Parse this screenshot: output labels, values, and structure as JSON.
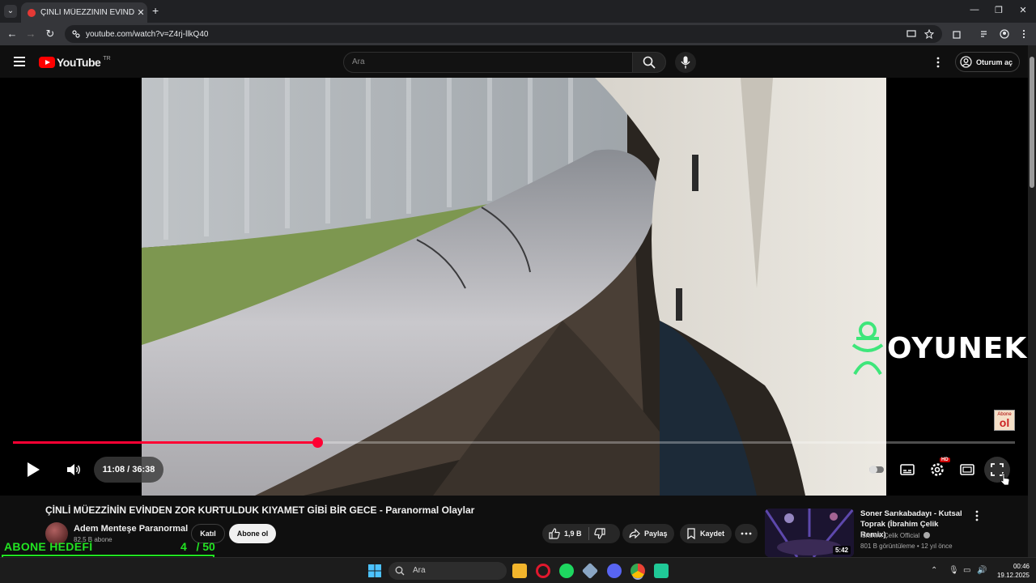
{
  "browser": {
    "tab_title": "ÇİNLİ MÜEZZİNİN EVİNDEN ZOR",
    "url": "youtube.com/watch?v=Z4rj-llkQ40"
  },
  "youtube": {
    "logo_text": "YouTube",
    "country_code": "TR",
    "search_placeholder": "Ara",
    "signin_label": "Oturum aç"
  },
  "player": {
    "time_display": "11:08 / 36:38",
    "progress_fraction": 0.304,
    "watermark_text": "OYUNEKS",
    "hd_badge": "HD",
    "abone_badge_top": "Abone",
    "abone_badge_main": "ol"
  },
  "video": {
    "title": "ÇİNLİ MÜEZZİNİN EVİNDEN ZOR KURTULDUK KIYAMET GİBİ BİR GECE - Paranormal Olaylar",
    "channel_name": "Adem Menteşe Paranormal",
    "subscribers": "82,5 B abone",
    "join_label": "Katıl",
    "subscribe_label": "Abone ol",
    "like_count": "1,9 B",
    "share_label": "Paylaş",
    "save_label": "Kaydet"
  },
  "recommendation": {
    "title": "Soner Sarıkabadayı - Kutsal Toprak (İbrahim Çelik Remix)",
    "channel": "İbrahim Çelik Official",
    "meta": "801 B görüntüleme • 12 yıl önce",
    "duration": "5:42"
  },
  "overlay": {
    "goal_label": "ABONE HEDEFİ",
    "goal_count": "4   / 50",
    "goal_fraction": 0.08
  },
  "taskbar": {
    "search_label": "Ara",
    "time": "00:46",
    "date": "19.12.2025"
  },
  "colors": {
    "accent": "#ff0033",
    "goal_green": "#22e322"
  }
}
